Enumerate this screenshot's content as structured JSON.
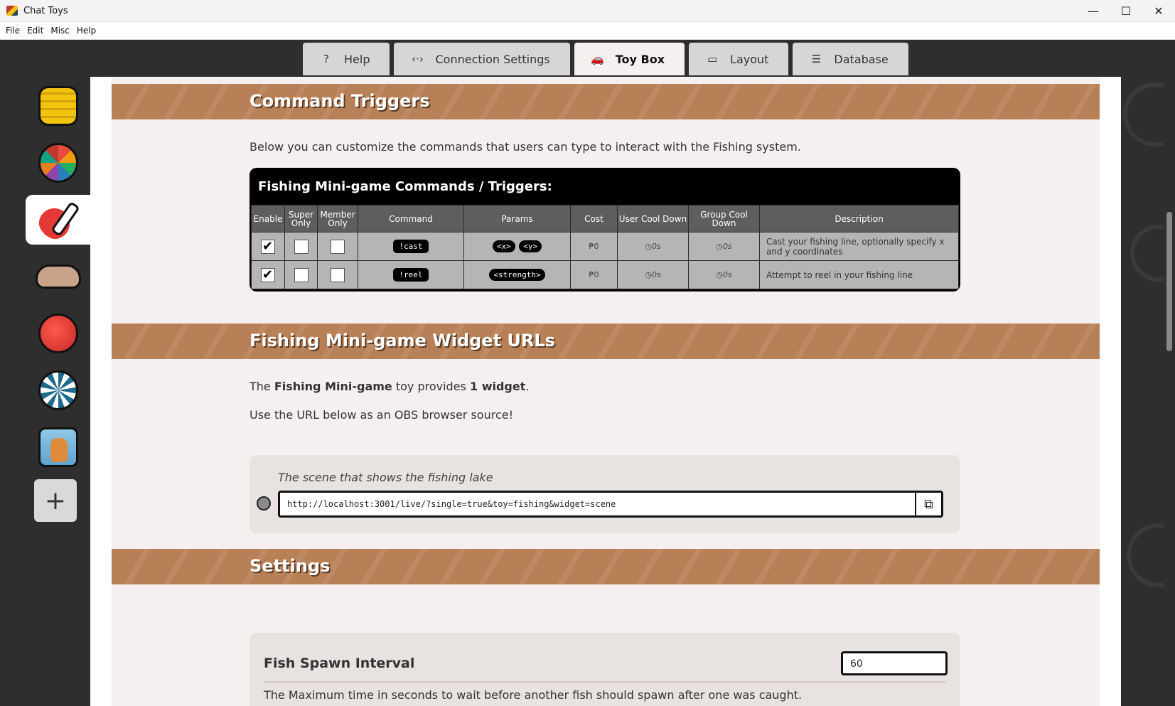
{
  "window": {
    "title": "Chat Toys",
    "minimize": "—",
    "maximize": "☐",
    "close": "✕"
  },
  "menu": [
    "File",
    "Edit",
    "Misc",
    "Help"
  ],
  "tabs": [
    {
      "label": "Help",
      "icon": "question-icon",
      "glyph": "?"
    },
    {
      "label": "Connection Settings",
      "icon": "code-arrows-icon",
      "glyph": "‹·›"
    },
    {
      "label": "Toy Box",
      "icon": "car-icon",
      "glyph": "🚗",
      "active": true
    },
    {
      "label": "Layout",
      "icon": "monitor-icon",
      "glyph": "▭"
    },
    {
      "label": "Database",
      "icon": "database-icon",
      "glyph": "☰"
    }
  ],
  "sidebar": {
    "items": [
      "coins-icon",
      "prize-wheel-icon",
      "fishing-icon",
      "hand-icon",
      "tomato-icon",
      "poker-chip-icon",
      "cat-card-icon"
    ],
    "active_index": 2,
    "add_label": "+"
  },
  "sections": {
    "commands": {
      "heading": "Command Triggers",
      "intro": "Below you can customize the commands that users can type to interact with the Fishing system.",
      "table_title": "Fishing Mini-game Commands / Triggers:",
      "headers": [
        "Enable",
        "Super Only",
        "Member Only",
        "Command",
        "Params",
        "Cost",
        "User Cool Down",
        "Group Cool Down",
        "Description"
      ],
      "rows": [
        {
          "enable": true,
          "super_only": false,
          "member_only": false,
          "command": "!cast",
          "params": [
            "<x>",
            "<y>"
          ],
          "cost": "₱0",
          "user_cd": "0s",
          "group_cd": "0s",
          "description": "Cast your fishing line, optionally specify x and y coordinates"
        },
        {
          "enable": true,
          "super_only": false,
          "member_only": false,
          "command": "!reel",
          "params": [
            "<strength>"
          ],
          "cost": "₱0",
          "user_cd": "0s",
          "group_cd": "0s",
          "description": "Attempt to reel in your fishing line"
        }
      ]
    },
    "widgets": {
      "heading": "Fishing Mini-game Widget URLs",
      "line1_pre": "The ",
      "line1_toy": "Fishing Mini-game",
      "line1_mid": " toy provides ",
      "line1_count": "1 widget",
      "line1_post": ".",
      "line2": "Use the URL below as an OBS browser source!",
      "widget_label": "The scene that shows the fishing lake",
      "widget_url": "http://localhost:3001/live/?single=true&toy=fishing&widget=scene"
    },
    "settings": {
      "heading": "Settings",
      "fish_spawn_label": "Fish Spawn Interval",
      "fish_spawn_value": "60",
      "fish_spawn_help": "The Maximum time in seconds to wait before another fish should spawn after one was caught."
    }
  }
}
